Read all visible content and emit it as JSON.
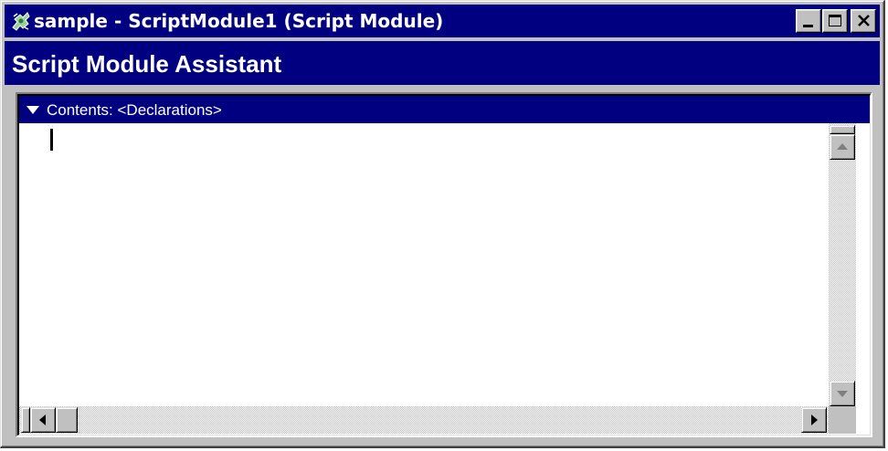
{
  "window": {
    "title": "sample - ScriptModule1 (Script Module)",
    "icon": "script-module-app-icon",
    "controls": [
      "minimize-icon",
      "maximize-icon",
      "close-icon"
    ]
  },
  "assistant": {
    "title": "Script Module Assistant"
  },
  "contents": {
    "label": "Contents: <Declarations>",
    "toggle_icon": "triangle-down-icon"
  },
  "editor": {
    "text": ""
  },
  "colors": {
    "title_bar": "#000080",
    "face": "#c0c0c0",
    "text_light": "#ffffff"
  }
}
